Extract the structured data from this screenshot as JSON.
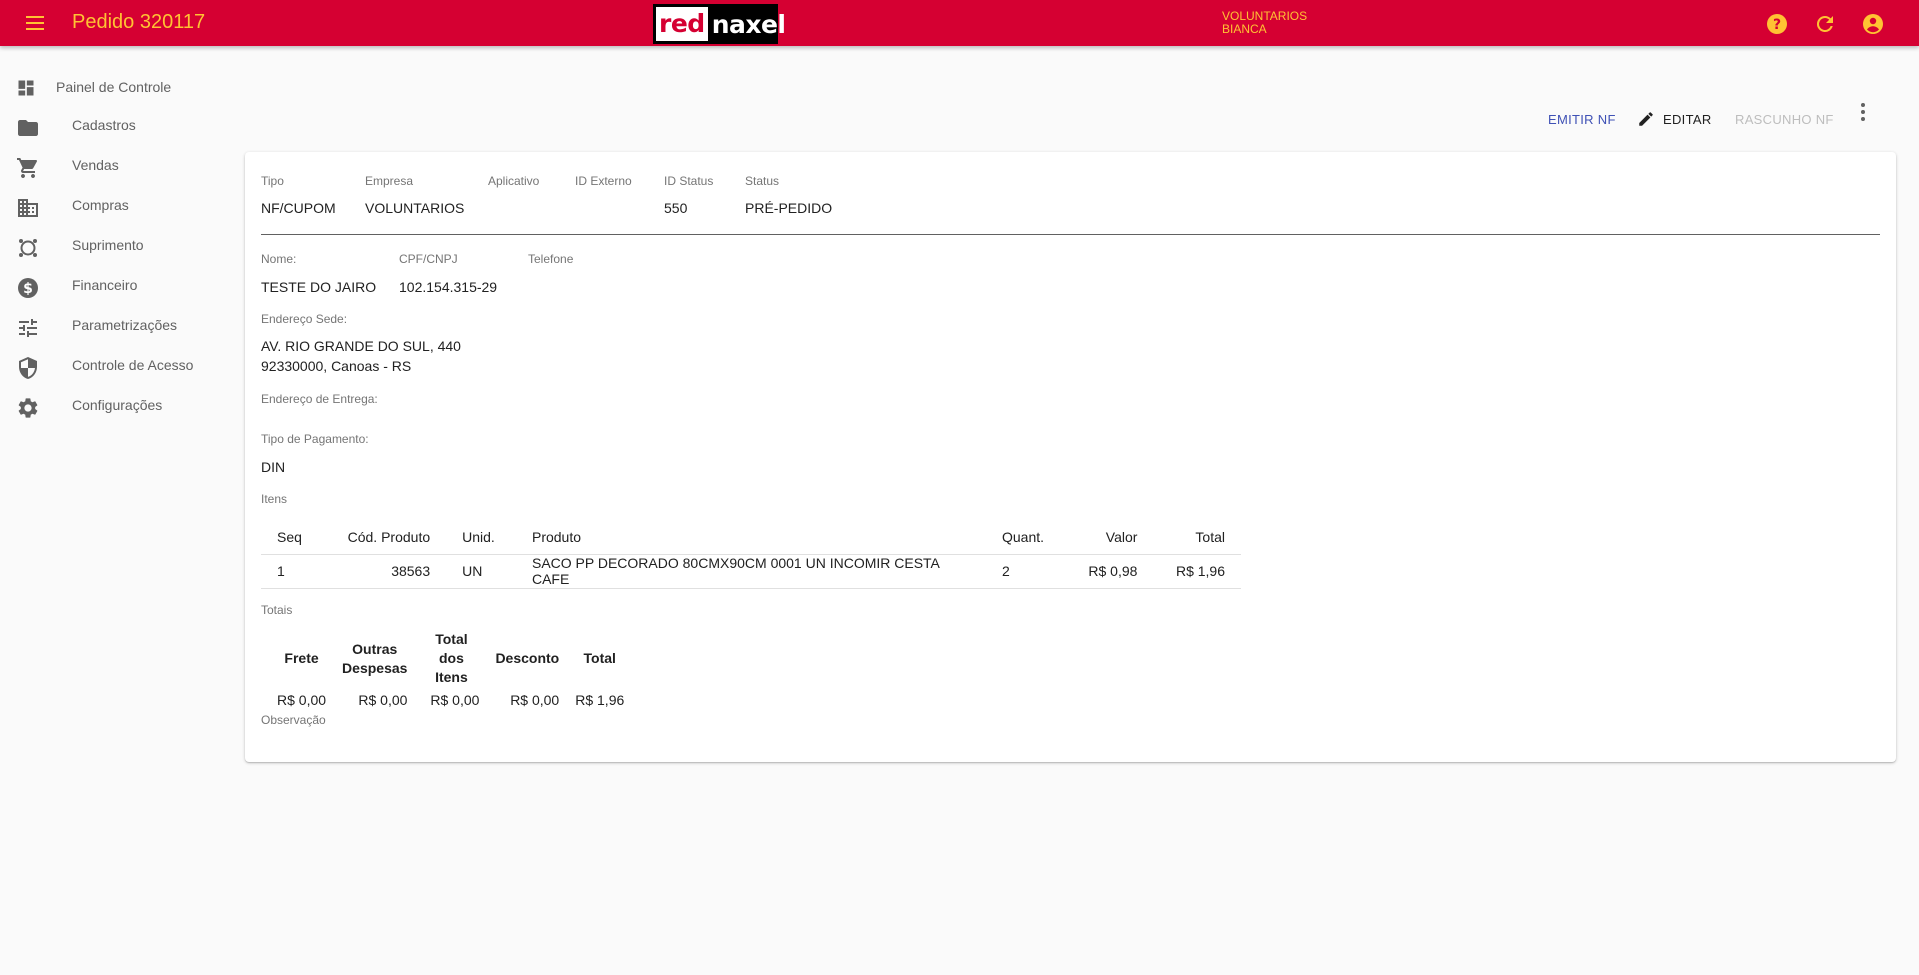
{
  "toolbar": {
    "title": "Pedido 320117",
    "logo_left": "red",
    "logo_right": "naxel",
    "company": "VOLUNTARIOS",
    "user": "BIANCA",
    "icons": [
      "help-icon",
      "refresh-icon",
      "account-icon"
    ]
  },
  "sidebar": {
    "items": [
      {
        "label": "Painel de Controle",
        "icon": "dashboard-icon"
      },
      {
        "label": "Cadastros",
        "icon": "folder-icon"
      },
      {
        "label": "Vendas",
        "icon": "cart-icon"
      },
      {
        "label": "Compras",
        "icon": "business-icon"
      },
      {
        "label": "Suprimento",
        "icon": "supply-icon"
      },
      {
        "label": "Financeiro",
        "icon": "dollar-icon"
      },
      {
        "label": "Parametrizações",
        "icon": "tune-icon"
      },
      {
        "label": "Controle de Acesso",
        "icon": "shield-icon"
      },
      {
        "label": "Configurações",
        "icon": "gear-icon"
      }
    ]
  },
  "actions": {
    "emit": "EMITIR NF",
    "edit": "EDITAR",
    "draft": "RASCUNHO NF"
  },
  "header_fields": {
    "tipo_label": "Tipo",
    "tipo": "NF/CUPOM",
    "empresa_label": "Empresa",
    "empresa": "VOLUNTARIOS",
    "aplicativo_label": "Aplicativo",
    "aplicativo": "",
    "id_externo_label": "ID Externo",
    "id_externo": "",
    "id_status_label": "ID Status",
    "id_status": "550",
    "status_label": "Status",
    "status": "PRÉ-PEDIDO"
  },
  "customer": {
    "nome_label": "Nome:",
    "nome": "TESTE DO JAIRO",
    "cpf_label": "CPF/CNPJ",
    "cpf": "102.154.315-29",
    "telefone_label": "Telefone",
    "telefone": "",
    "endereco_sede_label": "Endereço Sede:",
    "endereco_linha1": "AV. RIO GRANDE DO SUL, 440",
    "endereco_linha2": "92330000, Canoas - RS",
    "endereco_entrega_label": "Endereço de Entrega:",
    "pagamento_label": "Tipo de Pagamento:",
    "pagamento": "DIN"
  },
  "items": {
    "label": "Itens",
    "headers": [
      "Seq",
      "Cód. Produto",
      "Unid.",
      "Produto",
      "Quant.",
      "Valor",
      "Total"
    ],
    "rows": [
      [
        "1",
        "38563",
        "UN",
        "SACO PP DECORADO 80CMX90CM 0001 UN INCOMIR CESTA CAFE",
        "2",
        "R$ 0,98",
        "R$ 1,96"
      ]
    ]
  },
  "totals": {
    "label": "Totais",
    "headers": [
      "Frete",
      "Outras Despesas",
      "Total dos Itens",
      "Desconto",
      "Total"
    ],
    "values": [
      "R$ 0,00",
      "R$ 0,00",
      "R$ 0,00",
      "R$ 0,00",
      "R$ 1,96"
    ]
  },
  "observacao_label": "Observação",
  "colors": {
    "primary": "#d50032",
    "accent": "#ffc233",
    "link": "#3f51b5"
  }
}
